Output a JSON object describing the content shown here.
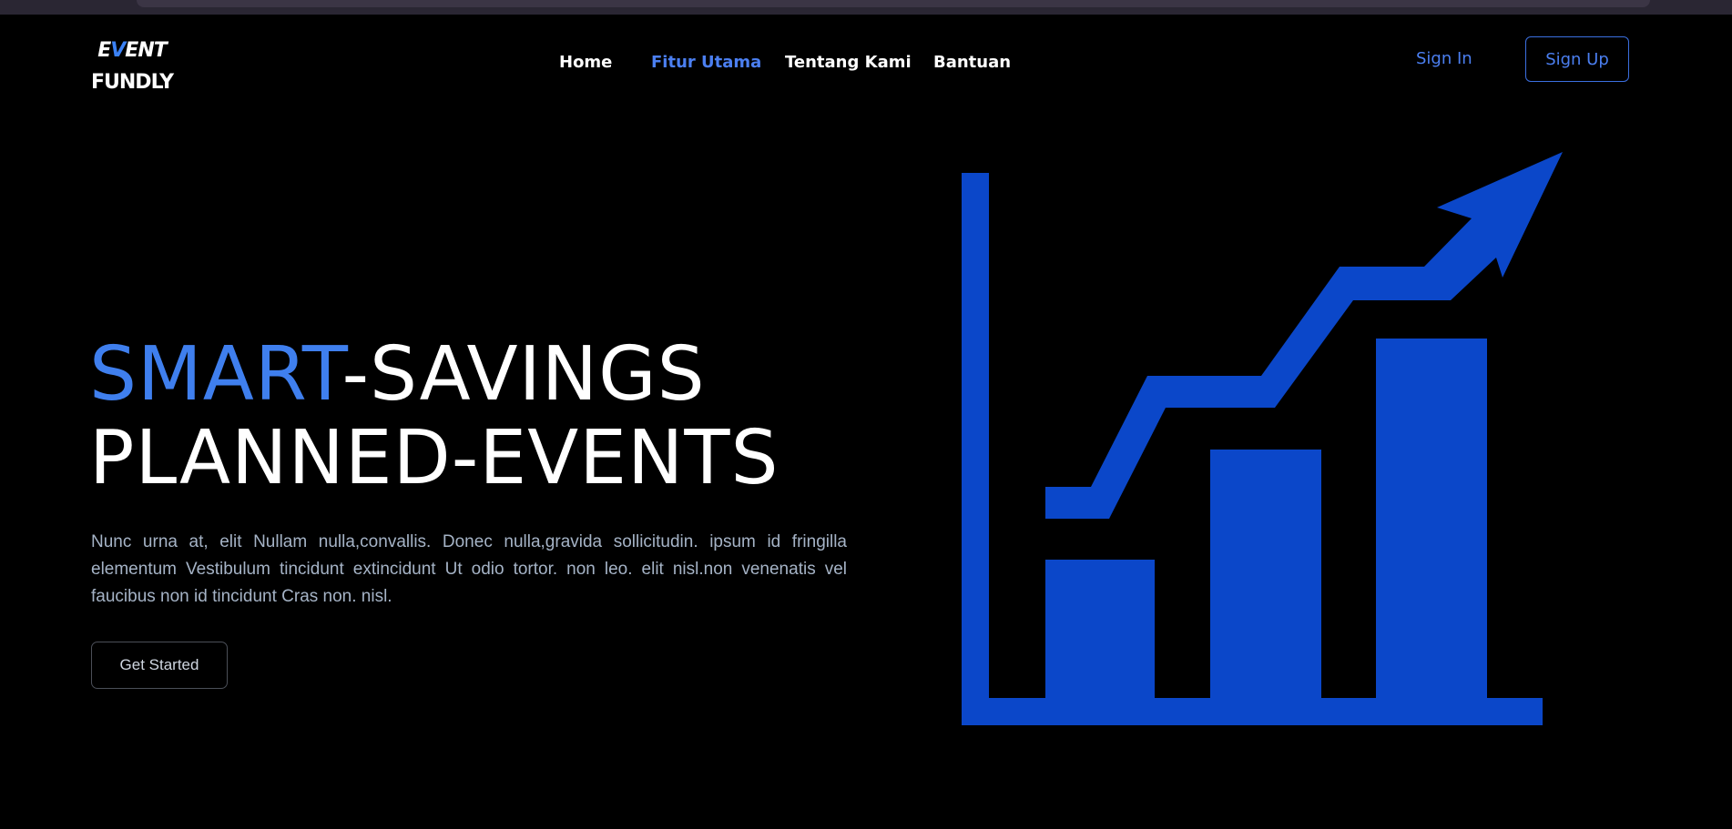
{
  "brand": {
    "logo_line1_prefix": "E",
    "logo_line1_accent": "V",
    "logo_line1_suffix": "ENT",
    "logo_line2": "FUNDLY",
    "accent_color": "#3b82f6"
  },
  "nav": {
    "items": [
      {
        "label": "Home",
        "active": false
      },
      {
        "label": "Fitur Utama",
        "active": true
      },
      {
        "label": "Tentang Kami",
        "active": false
      },
      {
        "label": "Bantuan",
        "active": false
      }
    ],
    "sign_in_label": "Sign In",
    "sign_up_label": "Sign Up"
  },
  "hero": {
    "title_accent": "SMART",
    "title_rest_line1": "-SAVINGS",
    "title_line2": "PLANNED-EVENTS",
    "description": "Nunc urna at, elit Nullam nulla,convallis. Donec nulla,gravida sollicitudin. ipsum id fringilla elementum Vestibulum tincidunt extincidunt Ut odio tortor. non leo. elit nisl.non venenatis vel faucibus non id tincidunt Cras non. nisl.",
    "cta_label": "Get Started"
  },
  "illustration": {
    "icon": "growth-chart-icon",
    "color": "#0b47c9"
  }
}
